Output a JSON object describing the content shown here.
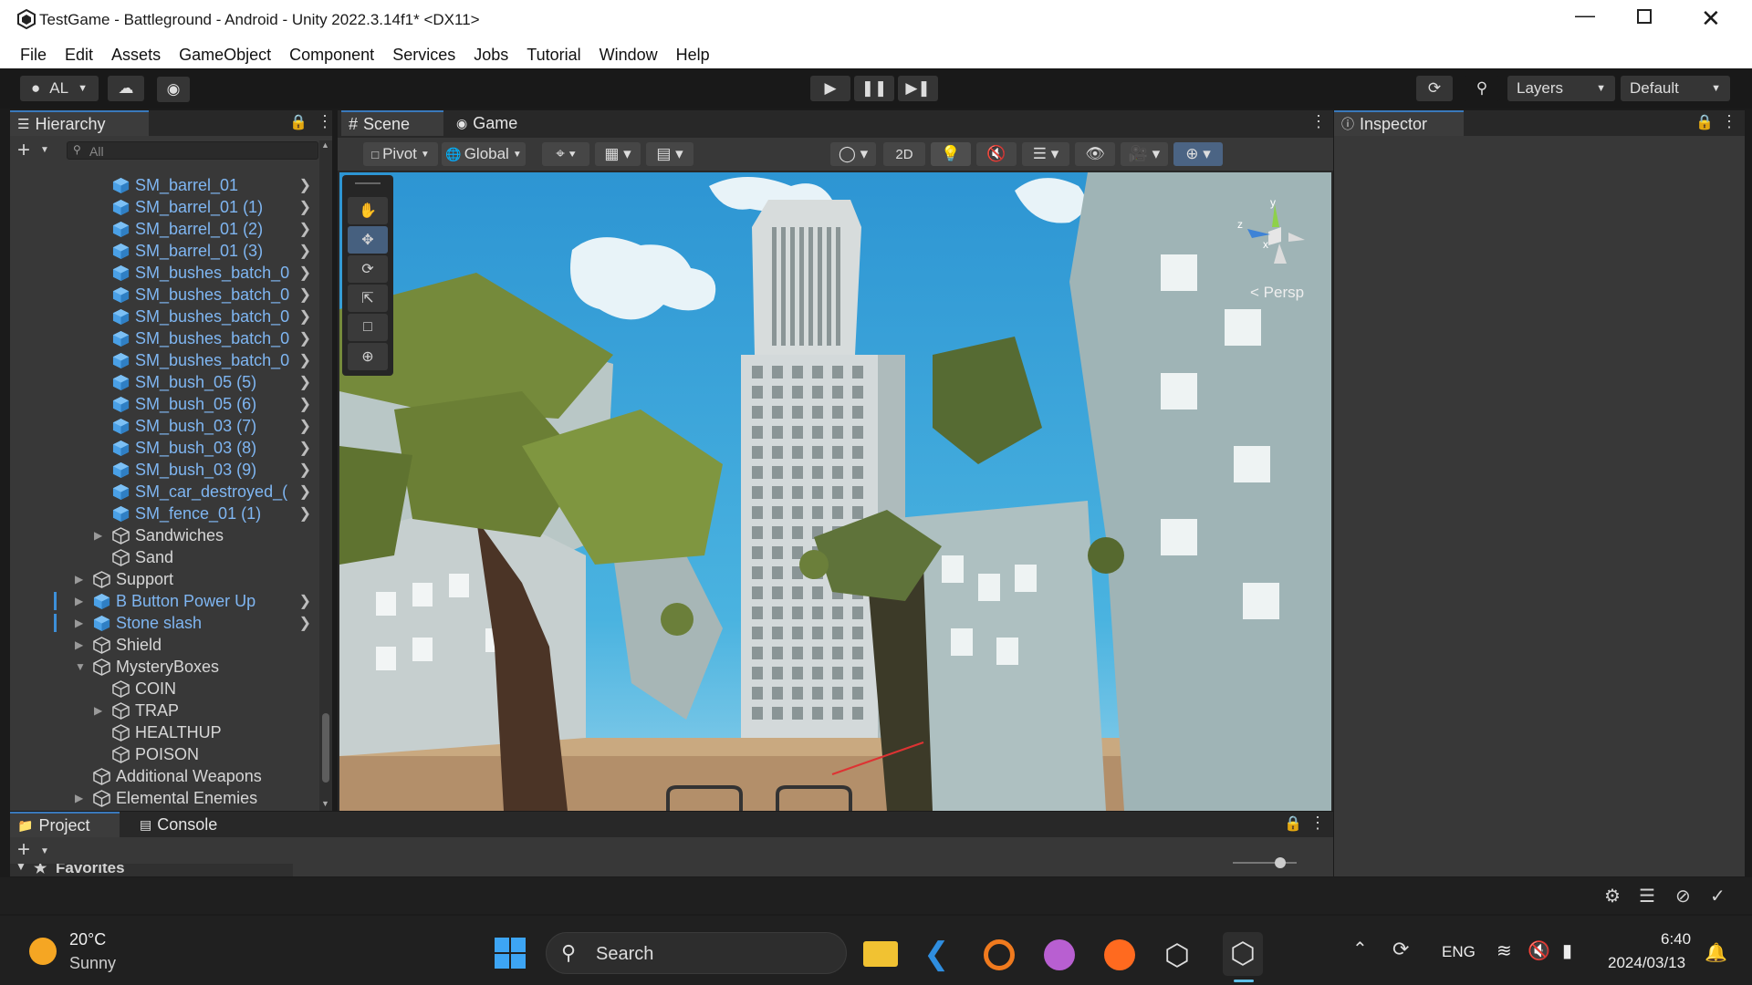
{
  "window": {
    "title": "TestGame - Battleground - Android - Unity 2022.3.14f1* <DX11>"
  },
  "menu": [
    "File",
    "Edit",
    "Assets",
    "GameObject",
    "Component",
    "Services",
    "Jobs",
    "Tutorial",
    "Window",
    "Help"
  ],
  "toolbar": {
    "account": "AL",
    "layers": "Layers",
    "layout": "Default"
  },
  "hierarchy": {
    "tab": "Hierarchy",
    "search_placeholder": "All",
    "rows": [
      {
        "label": "SM_barrel_01",
        "type": "prefab",
        "depth": 2,
        "chevron": true
      },
      {
        "label": "SM_barrel_01 (1)",
        "type": "prefab",
        "depth": 2,
        "chevron": true
      },
      {
        "label": "SM_barrel_01 (2)",
        "type": "prefab",
        "depth": 2,
        "chevron": true
      },
      {
        "label": "SM_barrel_01 (3)",
        "type": "prefab",
        "depth": 2,
        "chevron": true
      },
      {
        "label": "SM_bushes_batch_0",
        "type": "prefab",
        "depth": 2,
        "chevron": true
      },
      {
        "label": "SM_bushes_batch_0",
        "type": "prefab",
        "depth": 2,
        "chevron": true
      },
      {
        "label": "SM_bushes_batch_0",
        "type": "prefab",
        "depth": 2,
        "chevron": true
      },
      {
        "label": "SM_bushes_batch_0",
        "type": "prefab",
        "depth": 2,
        "chevron": true
      },
      {
        "label": "SM_bushes_batch_0",
        "type": "prefab",
        "depth": 2,
        "chevron": true
      },
      {
        "label": "SM_bush_05 (5)",
        "type": "prefab",
        "depth": 2,
        "chevron": true
      },
      {
        "label": "SM_bush_05 (6)",
        "type": "prefab",
        "depth": 2,
        "chevron": true
      },
      {
        "label": "SM_bush_03 (7)",
        "type": "prefab",
        "depth": 2,
        "chevron": true
      },
      {
        "label": "SM_bush_03 (8)",
        "type": "prefab",
        "depth": 2,
        "chevron": true
      },
      {
        "label": "SM_bush_03 (9)",
        "type": "prefab",
        "depth": 2,
        "chevron": true
      },
      {
        "label": "SM_car_destroyed_(",
        "type": "prefab",
        "depth": 2,
        "chevron": true
      },
      {
        "label": "SM_fence_01 (1)",
        "type": "prefab",
        "depth": 2,
        "chevron": true
      },
      {
        "label": "Sandwiches",
        "type": "object",
        "depth": 2,
        "fold": "collapsed"
      },
      {
        "label": "Sand",
        "type": "object",
        "depth": 2
      },
      {
        "label": "Support",
        "type": "object",
        "depth": 1,
        "fold": "collapsed"
      },
      {
        "label": "B Button Power Up",
        "type": "prefab",
        "depth": 1,
        "fold": "collapsed",
        "chevron": true,
        "marker": true
      },
      {
        "label": "Stone slash",
        "type": "prefab",
        "depth": 1,
        "fold": "collapsed",
        "chevron": true,
        "marker": true
      },
      {
        "label": "Shield",
        "type": "object",
        "depth": 1,
        "fold": "collapsed"
      },
      {
        "label": "MysteryBoxes",
        "type": "object",
        "depth": 1,
        "fold": "expanded"
      },
      {
        "label": "COIN",
        "type": "object",
        "depth": 2
      },
      {
        "label": "TRAP",
        "type": "object",
        "depth": 2,
        "fold": "collapsed"
      },
      {
        "label": "HEALTHUP",
        "type": "object",
        "depth": 2
      },
      {
        "label": "POISON",
        "type": "object",
        "depth": 2
      },
      {
        "label": "Additional Weapons",
        "type": "object",
        "depth": 1
      },
      {
        "label": "Elemental Enemies",
        "type": "object",
        "depth": 1,
        "fold": "collapsed"
      }
    ]
  },
  "scene": {
    "tabs": [
      "Scene",
      "Game"
    ],
    "pivot": "Pivot",
    "global": "Global",
    "mode_2d": "2D",
    "persp_label": "< Persp",
    "gizmo_axes": [
      "y",
      "z",
      "x"
    ]
  },
  "inspector": {
    "tab": "Inspector"
  },
  "bottom": {
    "tabs": [
      "Project",
      "Console"
    ],
    "favorites": "Favorites"
  },
  "taskbar": {
    "weather_temp": "20°C",
    "weather_desc": "Sunny",
    "search": "Search",
    "lang": "ENG",
    "time": "6:40",
    "date": "2024/03/13"
  }
}
